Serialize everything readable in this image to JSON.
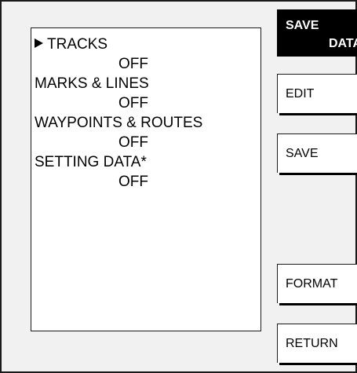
{
  "menu_title": {
    "line1": "SAVE",
    "line2": "DATA"
  },
  "items": [
    {
      "label": "TRACKS",
      "value": "OFF",
      "selected": true
    },
    {
      "label": "MARKS & LINES",
      "value": "OFF",
      "selected": false
    },
    {
      "label": "WAYPOINTS & ROUTES",
      "value": "OFF",
      "selected": false
    },
    {
      "label": "SETTING DATA*",
      "value": "OFF",
      "selected": false
    }
  ],
  "softkeys": {
    "edit": "EDIT",
    "save": "SAVE",
    "format": "FORMAT",
    "return": "RETURN"
  }
}
